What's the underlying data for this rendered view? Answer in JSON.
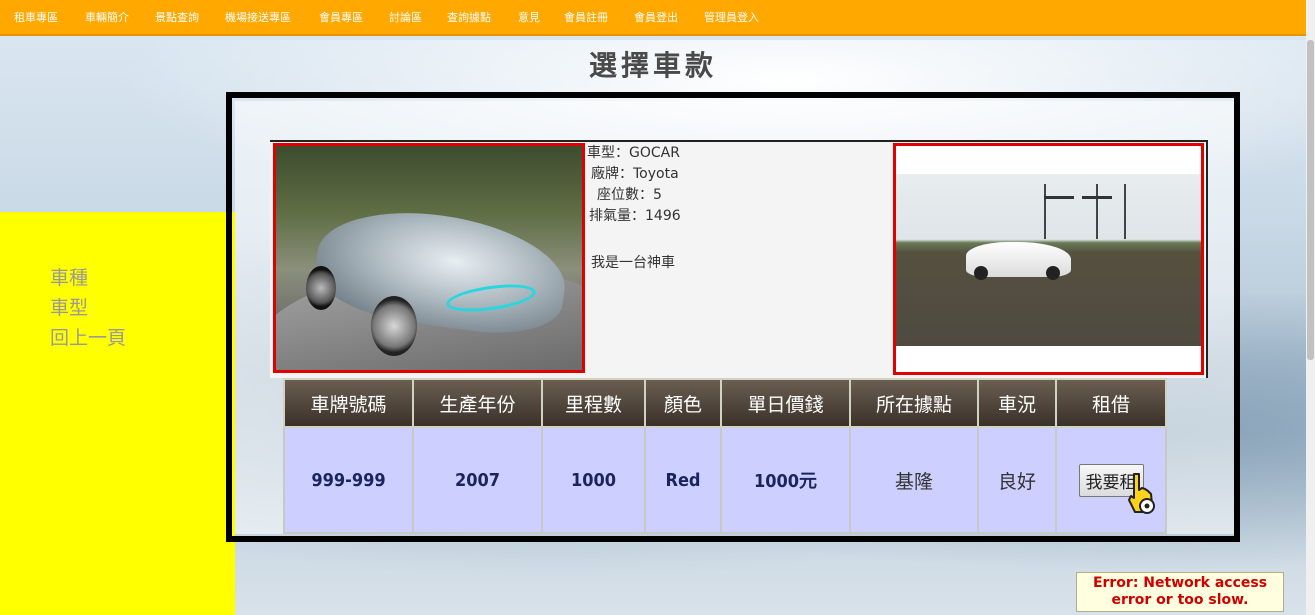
{
  "nav": {
    "items": [
      "租車專區",
      "車輛簡介",
      "景點查詢",
      "機場接送專區",
      "會員專區",
      "討論區",
      "查詢據點",
      "意見",
      "會員註冊",
      "會員登出",
      "管理員登入"
    ]
  },
  "page": {
    "title": "選擇車款"
  },
  "sidebar": {
    "items": [
      "車種",
      "車型",
      "回上一頁"
    ]
  },
  "car": {
    "model_line": "車型：GOCAR",
    "brand_line": "廠牌：Toyota",
    "seats_line": "座位數：5",
    "displacement_line": "排氣量：1496",
    "description": "我是一台神車"
  },
  "table": {
    "headers": [
      "車牌號碼",
      "生產年份",
      "里程數",
      "顏色",
      "單日價錢",
      "所在據點",
      "車況",
      "租借"
    ],
    "row": {
      "plate": "999-999",
      "year": "2007",
      "mileage": "1000",
      "color": "Red",
      "price": "1000元",
      "location": "基隆",
      "condition": "良好",
      "rent_button": "我要租"
    }
  },
  "error": {
    "line1": "Error: Network access",
    "line2": "error or too slow."
  },
  "colors": {
    "nav_bg": "#ffa800",
    "sidebar_bg": "#ffff00",
    "table_cell_bg": "#cdd0ff",
    "error_text": "#d00000"
  }
}
